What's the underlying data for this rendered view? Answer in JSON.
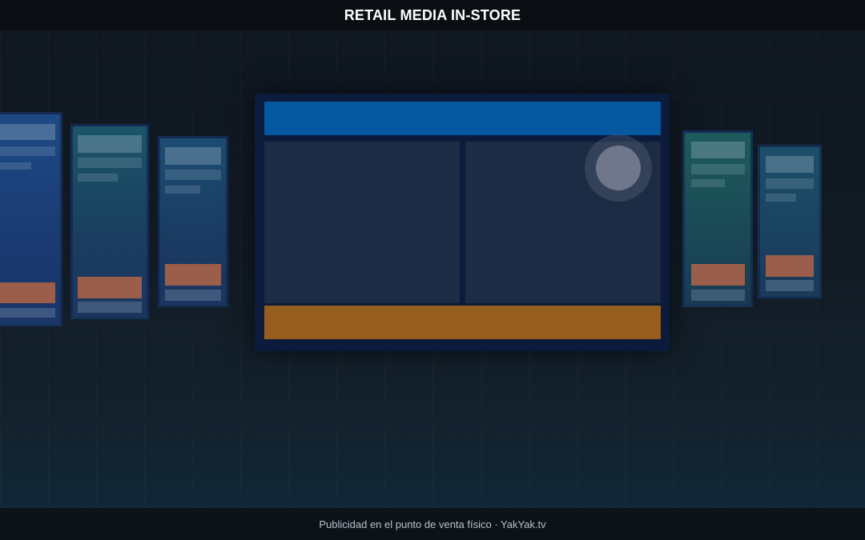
{
  "header": {
    "title": "RETAIL MEDIA IN-STORE"
  },
  "footer": {
    "caption": "Publicidad en el punto de venta físico · YakYak.tv"
  },
  "colors": {
    "header_bg": "#0a0e13",
    "main_top_band": "#0558a0",
    "main_bottom_band": "#955e1e",
    "panel_cta": "#9b5e4a",
    "panel_blue": "#1c3f7a",
    "panel_teal": "#1b4d5e",
    "panel_green": "#1d4f4a"
  }
}
